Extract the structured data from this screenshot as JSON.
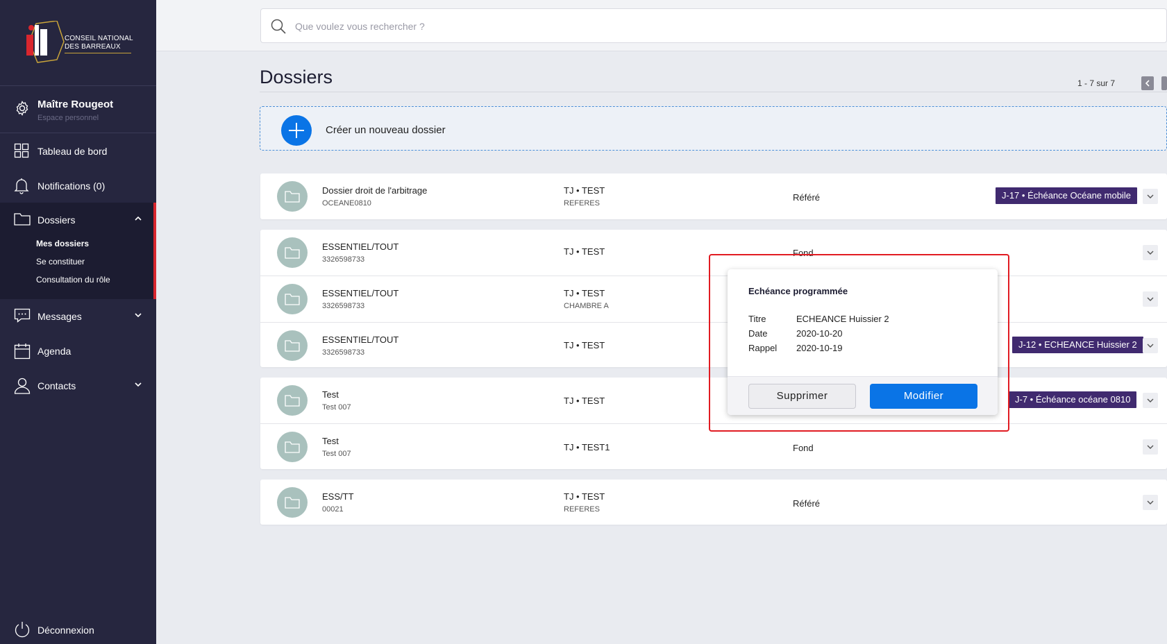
{
  "sidebar": {
    "logo_line1": "CONSEIL NATIONAL",
    "logo_line2": "DES BARREAUX",
    "profile_name": "Maître Rougeot",
    "profile_sub": "Espace personnel",
    "dashboard": "Tableau de bord",
    "notifications": "Notifications (0)",
    "dossiers": "Dossiers",
    "sub_mes_dossiers": "Mes dossiers",
    "sub_se_constituer": "Se constituer",
    "sub_consultation": "Consultation du rôle",
    "messages": "Messages",
    "agenda": "Agenda",
    "contacts": "Contacts",
    "logout": "Déconnexion"
  },
  "search": {
    "placeholder": "Que voulez vous rechercher ?"
  },
  "main": {
    "title": "Dossiers",
    "pagination": "1 - 7 sur 7",
    "create_label": "Créer un nouveau dossier"
  },
  "rows": [
    {
      "name": "Dossier droit de l'arbitrage",
      "code": "OCEANE0810",
      "jur": "TJ • TEST",
      "chamber": "REFERES",
      "type": "Référé",
      "badge": "J-17 • Échéance Océane mobile"
    },
    {
      "name": "ESSENTIEL/TOUT",
      "code": "3326598733",
      "jur": "TJ • TEST",
      "chamber": "",
      "type": "Fond",
      "badge": ""
    },
    {
      "name": "ESSENTIEL/TOUT",
      "code": "3326598733",
      "jur": "TJ • TEST",
      "chamber": "CHAMBRE A",
      "type": "",
      "badge": ""
    },
    {
      "name": "ESSENTIEL/TOUT",
      "code": "3326598733",
      "jur": "TJ • TEST",
      "chamber": "",
      "type": "",
      "badge": "J-12 • ECHEANCE Huissier 2"
    },
    {
      "name": "Test",
      "code": "Test 007",
      "jur": "TJ • TEST",
      "chamber": "",
      "type": "",
      "badge": "J-7 • Échéance océane 0810"
    },
    {
      "name": "Test",
      "code": "Test 007",
      "jur": "TJ • TEST1",
      "chamber": "",
      "type": "Fond",
      "badge": ""
    },
    {
      "name": "ESS/TT",
      "code": "00021",
      "jur": "TJ • TEST",
      "chamber": "REFERES",
      "type": "Référé",
      "badge": ""
    }
  ],
  "popover": {
    "title": "Echéance programmée",
    "k_titre": "Titre",
    "v_titre": "ECHEANCE Huissier 2",
    "k_date": "Date",
    "v_date": "2020-10-20",
    "k_rappel": "Rappel",
    "v_rappel": "2020-10-19",
    "delete_label": "Supprimer",
    "edit_label": "Modifier"
  },
  "colors": {
    "sidebar_bg": "#26263f",
    "accent_red": "#d9262e",
    "primary_blue": "#0a74e6",
    "badge_purple": "#402a6f"
  }
}
